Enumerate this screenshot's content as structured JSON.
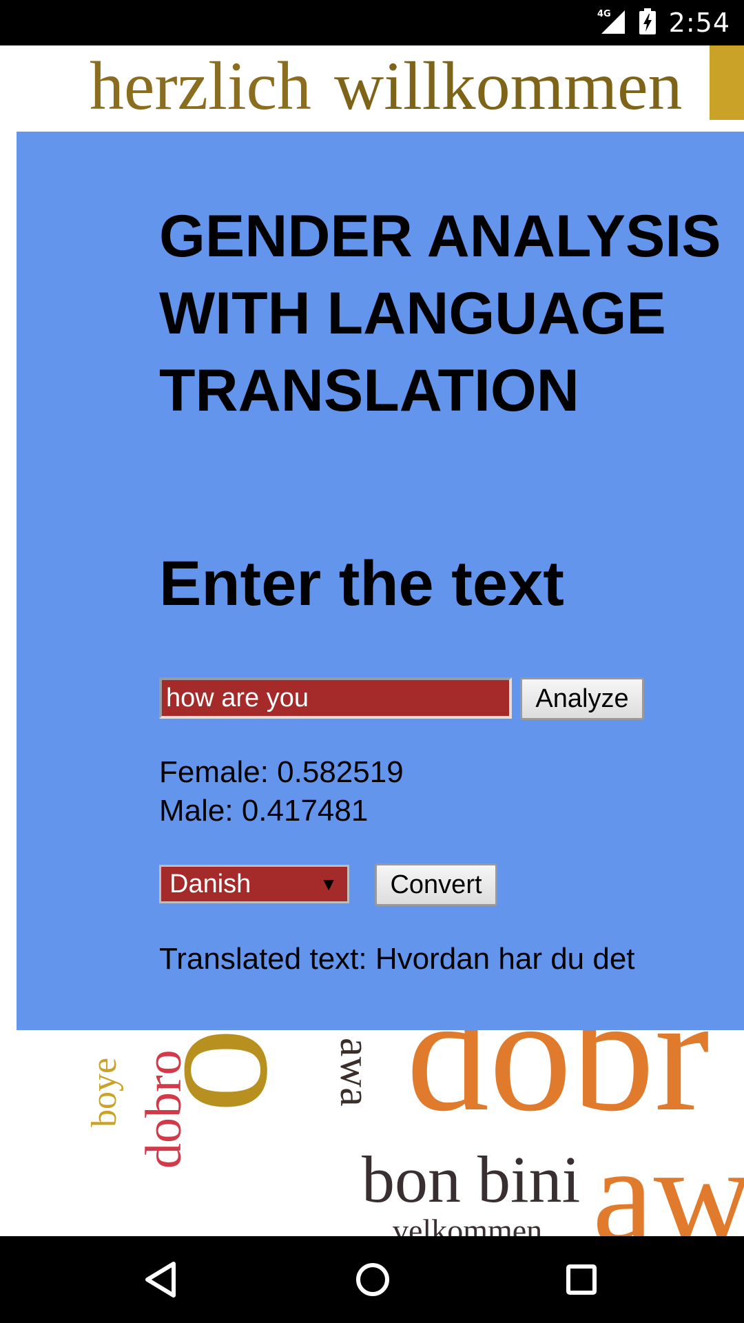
{
  "status_bar": {
    "network": "4G",
    "time": "2:54",
    "icons": [
      "signal-icon",
      "battery-charging-icon"
    ]
  },
  "background_words": {
    "top": [
      "herzlich",
      "willkommen"
    ],
    "bottom": [
      "boye",
      "dobro",
      "bo",
      "awa",
      "dobr",
      "bon bini",
      "awa",
      "velkommen"
    ]
  },
  "main": {
    "title_lines": [
      "GENDER ANALYSIS",
      "WITH LANGUAGE",
      "TRANSLATION"
    ],
    "heading": "Enter the text",
    "input_value": "how are you",
    "analyze_label": "Analyze",
    "female_result": "Female: 0.582519",
    "male_result": "Male: 0.417481",
    "language_selected": "Danish",
    "convert_label": "Convert",
    "translated_text": "Translated text: Hvordan har du det"
  },
  "colors": {
    "panel": "#6495ed",
    "input_background": "#a52a2a",
    "system_bar": "#000000"
  },
  "nav_bar": {
    "icons": [
      "back-icon",
      "home-icon",
      "recents-icon"
    ]
  }
}
